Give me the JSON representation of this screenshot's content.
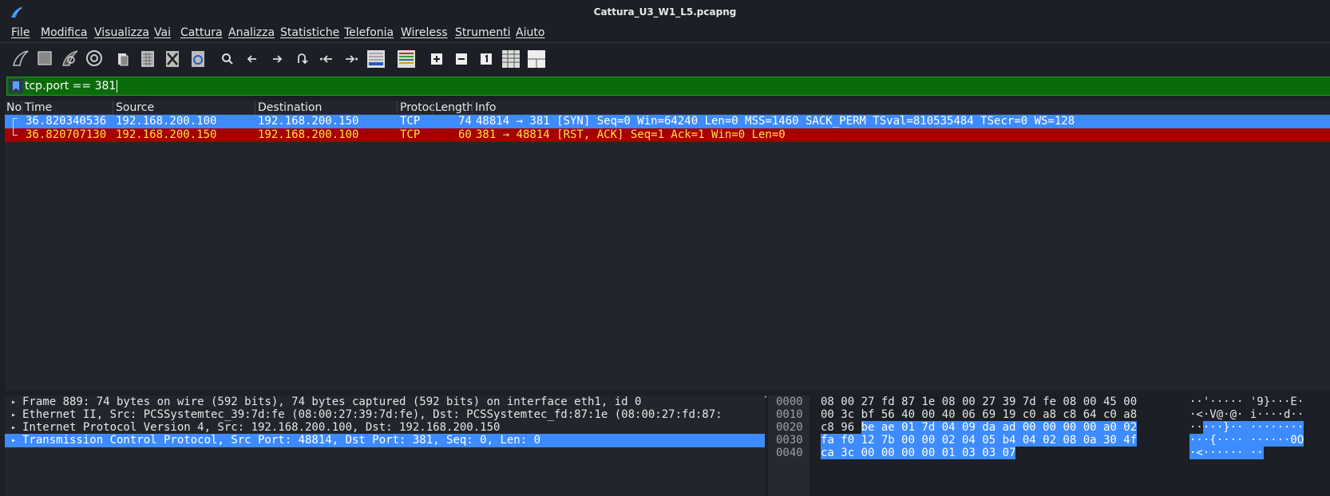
{
  "window": {
    "title": "Cattura_U3_W1_L5.pcapng"
  },
  "menu": [
    "File",
    "Modifica",
    "Visualizza",
    "Vai",
    "Cattura",
    "Analizza",
    "Statistiche",
    "Telefonia",
    "Wireless",
    "Strumenti",
    "Aiuto"
  ],
  "filter": {
    "value": "tcp.port == 381"
  },
  "columns": [
    "No",
    "Time",
    "Source",
    "Destination",
    "Protoc",
    "Length",
    "Info"
  ],
  "packets": [
    {
      "time": "36.820340536",
      "source": "192.168.200.100",
      "destination": "192.168.200.150",
      "protocol": "TCP",
      "length": "74",
      "info": "48814 → 381 [SYN] Seq=0 Win=64240 Len=0 MSS=1460 SACK_PERM TSval=810535484 TSecr=0 WS=128",
      "style": "selected"
    },
    {
      "time": "36.820707130",
      "source": "192.168.200.150",
      "destination": "192.168.200.100",
      "protocol": "TCP",
      "length": "60",
      "info": "381 → 48814 [RST, ACK] Seq=1 Ack=1 Win=0 Len=0",
      "style": "rst"
    }
  ],
  "details": [
    {
      "text": "Frame 889: 74 bytes on wire (592 bits), 74 bytes captured (592 bits) on interface eth1, id 0",
      "selected": false
    },
    {
      "text": "Ethernet II, Src: PCSSystemtec_39:7d:fe (08:00:27:39:7d:fe), Dst: PCSSystemtec_fd:87:1e (08:00:27:fd:87:",
      "selected": false
    },
    {
      "text": "Internet Protocol Version 4, Src: 192.168.200.100, Dst: 192.168.200.150",
      "selected": false
    },
    {
      "text": "Transmission Control Protocol, Src Port: 48814, Dst Port: 381, Seq: 0, Len: 0",
      "selected": true
    }
  ],
  "hex_dump": [
    {
      "offset": "0000",
      "hex_plain": "08 00 27 fd 87 1e 08 00  27 39 7d fe 08 00 45 00",
      "hex_hl": "",
      "ascii_plain": "··'····· '9}···E·",
      "ascii_hl": ""
    },
    {
      "offset": "0010",
      "hex_plain": "00 3c bf 56 40 00 40 06  69 19 c0 a8 c8 64 c0 a8",
      "hex_hl": "",
      "ascii_plain": "·<·V@·@· i····d··",
      "ascii_hl": ""
    },
    {
      "offset": "0020",
      "hex_plain": "c8 96 ",
      "hex_hl": "be ae 01 7d 04 09  da ad 00 00 00 00 a0 02",
      "ascii_plain": "··",
      "ascii_hl": "···}·· ········"
    },
    {
      "offset": "0030",
      "hex_plain": "",
      "hex_hl": "fa f0 12 7b 00 00 02 04  05 b4 04 02 08 0a 30 4f",
      "ascii_plain": "",
      "ascii_hl": "···{···· ······0O"
    },
    {
      "offset": "0040",
      "hex_plain": "",
      "hex_hl": "ca 3c 00 00 00 00 01 03  03 07",
      "ascii_plain": "",
      "ascii_hl": "·<······ ··"
    }
  ]
}
